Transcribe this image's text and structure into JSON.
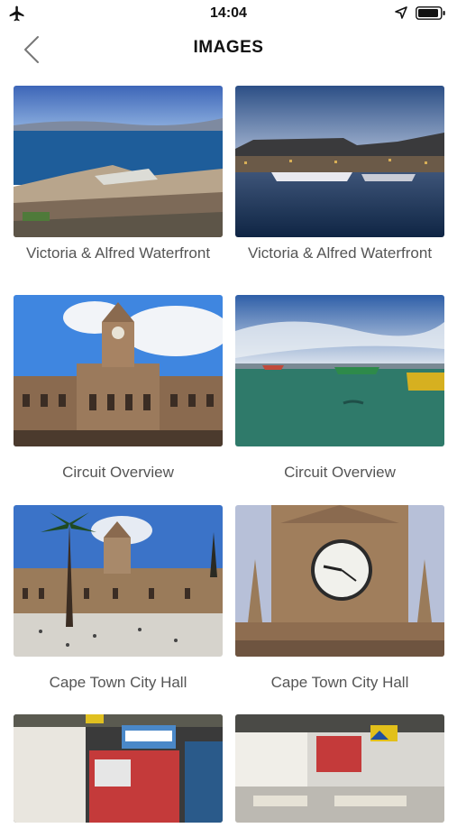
{
  "status_bar": {
    "time": "14:04",
    "icons": [
      "airplane-icon",
      "location-arrow-icon",
      "battery-icon"
    ]
  },
  "nav": {
    "back_icon": "chevron-left-icon",
    "title": "IMAGES"
  },
  "gallery": {
    "items": [
      {
        "caption": "Victoria & Alfred Waterfront"
      },
      {
        "caption": "Victoria & Alfred Waterfront"
      },
      {
        "caption": "Circuit Overview"
      },
      {
        "caption": "Circuit Overview"
      },
      {
        "caption": "Cape Town City Hall"
      },
      {
        "caption": "Cape Town City Hall"
      },
      {
        "caption": ""
      },
      {
        "caption": ""
      }
    ]
  }
}
